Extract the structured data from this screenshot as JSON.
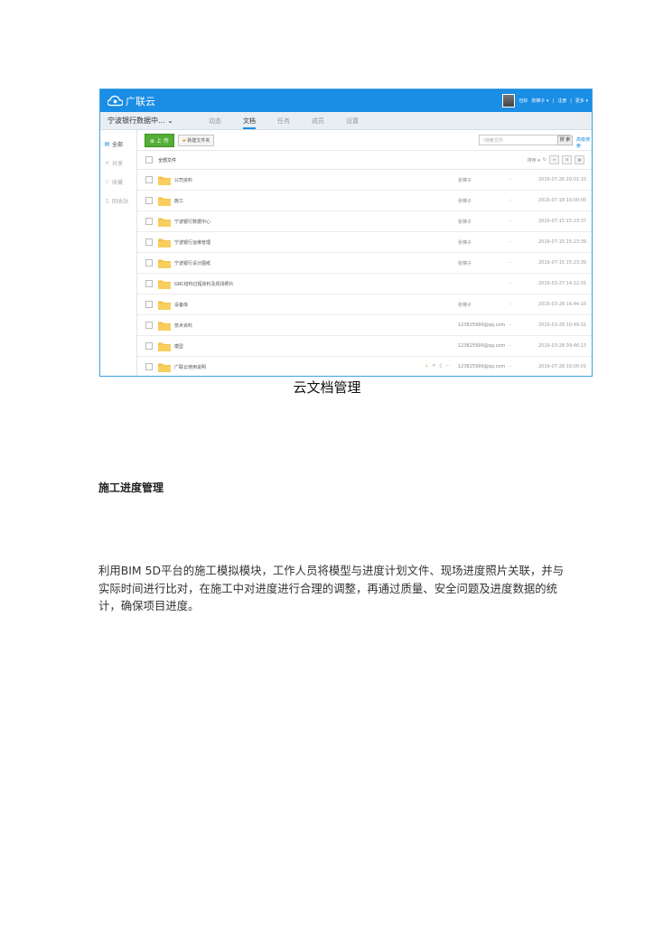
{
  "app": {
    "logo_text": "广联云",
    "user_area": [
      "也好",
      "张梯子 ▾",
      "|",
      "注册",
      "|",
      "更多 ▾"
    ]
  },
  "navbar": {
    "project": "宁波银行数据中... ⌄",
    "tabs": [
      "动态",
      "文档",
      "任务",
      "成员",
      "设置"
    ],
    "active_tab": "文档"
  },
  "sidebar": {
    "items": [
      {
        "icon": "folder-icon",
        "label": "全部"
      },
      {
        "icon": "share-icon",
        "label": "共享"
      },
      {
        "icon": "star-icon",
        "label": "收藏"
      },
      {
        "icon": "trash-icon",
        "label": "回收站"
      }
    ]
  },
  "toolbar": {
    "upload_label": "上 传",
    "new_folder_label": "新建文件夹",
    "search_placeholder": "搜索文件",
    "search_button": "搜 索",
    "advanced_link": "高级搜索"
  },
  "list": {
    "header_label": "全部文件",
    "sort_label": "排序 ▾",
    "rows": [
      {
        "name": "公司资料",
        "owner": "张梯子",
        "dash": "-",
        "date": "2016-07-26 20:01:10"
      },
      {
        "name": "施工",
        "owner": "张梯子",
        "dash": "-",
        "date": "2016-07-18 10:00:00"
      },
      {
        "name": "宁波银行数据中心",
        "owner": "张梯子",
        "dash": "-",
        "date": "2016-07-15 15:23:37"
      },
      {
        "name": "宁波银行运维管理",
        "owner": "张梯子",
        "dash": "-",
        "date": "2016-07-15 15:23:39"
      },
      {
        "name": "宁波银行设计图纸",
        "owner": "张梯子",
        "dash": "-",
        "date": "2016-07-15 15:23:39"
      },
      {
        "name": "GRC结构过程资料及现场照片",
        "owner": "",
        "dash": "-",
        "date": "2016-03-27 14:22:01"
      },
      {
        "name": "设备库",
        "owner": "张梯子",
        "dash": "-",
        "date": "2016-03-28 16:44:10"
      },
      {
        "name": "技术资料",
        "owner": "123825999@qq.com",
        "dash": "-",
        "date": "2016-03-28 10:49:31"
      },
      {
        "name": "模型",
        "owner": "123825999@qq.com",
        "dash": "-",
        "date": "2016-03-28 09:46:13"
      },
      {
        "name": "广联云使用说明",
        "owner": "123825999@qq.com",
        "dash": "-",
        "date": "2016-07-28 10:00:01",
        "actions": true
      }
    ]
  },
  "document": {
    "caption": "云文档管理",
    "heading": "施工进度管理",
    "paragraph": "利用BIM 5D平台的施工模拟模块，工作人员将模型与进度计划文件、现场进度照片关联，并与实际时间进行比对，在施工中对进度进行合理的调整，再通过质量、安全问题及进度数据的统计，确保项目进度。"
  }
}
